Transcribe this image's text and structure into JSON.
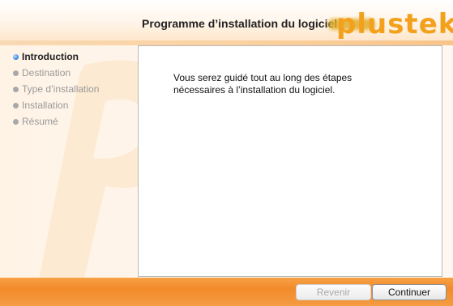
{
  "window": {
    "title": "Programme d’installation du logiciel",
    "brand": "plustek"
  },
  "sidebar": {
    "steps": [
      {
        "label": "Introduction",
        "state": "current"
      },
      {
        "label": "Destination",
        "state": "pending"
      },
      {
        "label": "Type d’installation",
        "state": "pending"
      },
      {
        "label": "Installation",
        "state": "pending"
      },
      {
        "label": "Résumé",
        "state": "pending"
      }
    ]
  },
  "main": {
    "lines": [
      "Vous serez guidé tout au long des étapes",
      "nécessaires à l’installation du logiciel."
    ]
  },
  "buttons": {
    "back_label": "Revenir",
    "back_enabled": false,
    "next_label": "Continuer",
    "next_enabled": true
  },
  "colors": {
    "accent": "#f28a2a",
    "brand": "#f3a11d",
    "current_step": "#3d8ee8"
  },
  "icons": {
    "current_step_icon": "blue-dot-icon",
    "pending_step_icon": "gray-dot-icon"
  }
}
